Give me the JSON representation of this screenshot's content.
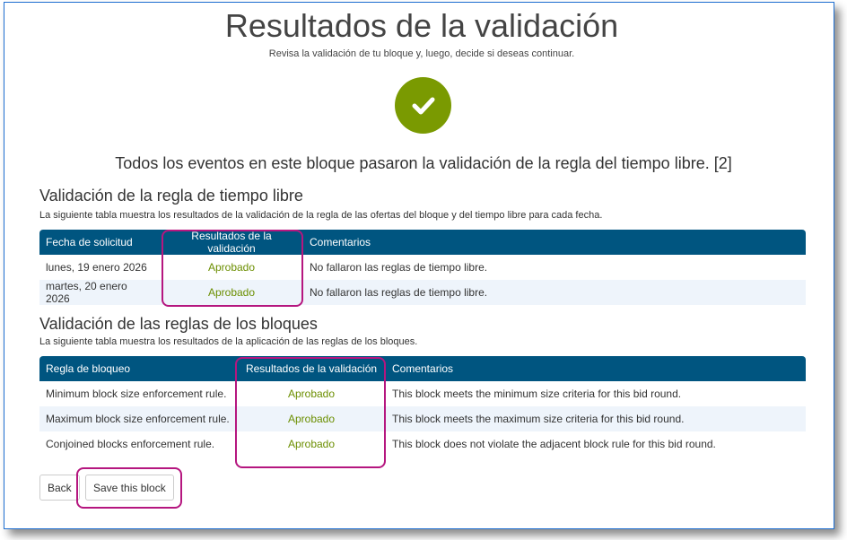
{
  "header": {
    "title": "Resultados de la validación",
    "subtitle": "Revisa la validación de tu bloque y, luego, decide si deseas continuar."
  },
  "status": {
    "summary": "Todos los eventos en este bloque pasaron la validación de la regla del tiempo libre. [2]",
    "color": "#7a9a01"
  },
  "free_time": {
    "heading": "Validación de la regla de tiempo libre",
    "description": "La siguiente tabla muestra los resultados de la validación de la regla de las ofertas del bloque y del tiempo libre para cada fecha.",
    "columns": [
      "Fecha de solicitud",
      "Resultados de la validación",
      "Comentarios"
    ],
    "rows": [
      {
        "date": "lunes, 19 enero 2026",
        "result": "Aprobado",
        "comment": "No fallaron las reglas de tiempo libre."
      },
      {
        "date": "martes, 20 enero 2026",
        "result": "Aprobado",
        "comment": "No fallaron las reglas de tiempo libre."
      }
    ]
  },
  "block_rules": {
    "heading": "Validación de las reglas de los bloques",
    "description": "La siguiente tabla muestra los resultados de la aplicación de las reglas de los bloques.",
    "columns": [
      "Regla de bloqueo",
      "Resultados de la validación",
      "Comentarios"
    ],
    "rows": [
      {
        "rule": "Minimum block size enforcement rule.",
        "result": "Aprobado",
        "comment": "This block meets the minimum size criteria for this bid round."
      },
      {
        "rule": "Maximum block size enforcement rule.",
        "result": "Aprobado",
        "comment": "This block meets the maximum size criteria for this bid round."
      },
      {
        "rule": "Conjoined blocks enforcement rule.",
        "result": "Aprobado",
        "comment": "This block does not violate the adjacent block rule for this bid round."
      }
    ]
  },
  "actions": {
    "back_label": "Back",
    "save_label": "Save this block"
  },
  "colors": {
    "header_bg": "#005580",
    "approved": "#6b8e00",
    "highlight": "#b5167f"
  }
}
